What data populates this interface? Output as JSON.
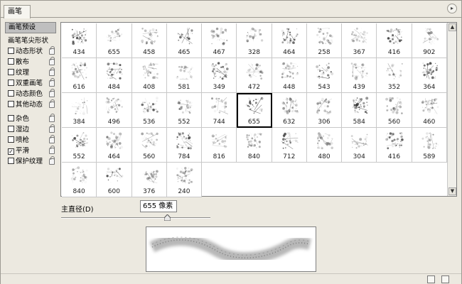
{
  "panel": {
    "tab_label": "画笔",
    "menu_glyph": "▸"
  },
  "options": {
    "presets_label": "画笔预设",
    "tip_shape_label": "画笔笔尖形状",
    "items": [
      {
        "label": "动态形状",
        "checked": false
      },
      {
        "label": "散布",
        "checked": false
      },
      {
        "label": "纹理",
        "checked": false
      },
      {
        "label": "双重画笔",
        "checked": false
      },
      {
        "label": "动态颜色",
        "checked": false
      },
      {
        "label": "其他动态",
        "checked": false
      },
      {
        "label": "杂色",
        "checked": false
      },
      {
        "label": "湿边",
        "checked": false
      },
      {
        "label": "喷枪",
        "checked": false
      },
      {
        "label": "平滑",
        "checked": true
      },
      {
        "label": "保护纹理",
        "checked": false
      }
    ],
    "check_glyph": "✓"
  },
  "brushes": [
    "434",
    "655",
    "458",
    "465",
    "467",
    "328",
    "464",
    "258",
    "367",
    "416",
    "902",
    "616",
    "484",
    "408",
    "581",
    "349",
    "472",
    "448",
    "543",
    "439",
    "352",
    "364",
    "384",
    "496",
    "536",
    "552",
    "744",
    "655",
    "632",
    "306",
    "584",
    "560",
    "460",
    "552",
    "464",
    "560",
    "784",
    "816",
    "840",
    "712",
    "480",
    "304",
    "416",
    "589",
    "840",
    "600",
    "376",
    "240"
  ],
  "selected_index": 27,
  "diameter": {
    "label": "主直径(D)",
    "value": "655 像素",
    "slider_fraction": 0.71
  },
  "scroll": {
    "up": "▲",
    "down": "▼"
  }
}
